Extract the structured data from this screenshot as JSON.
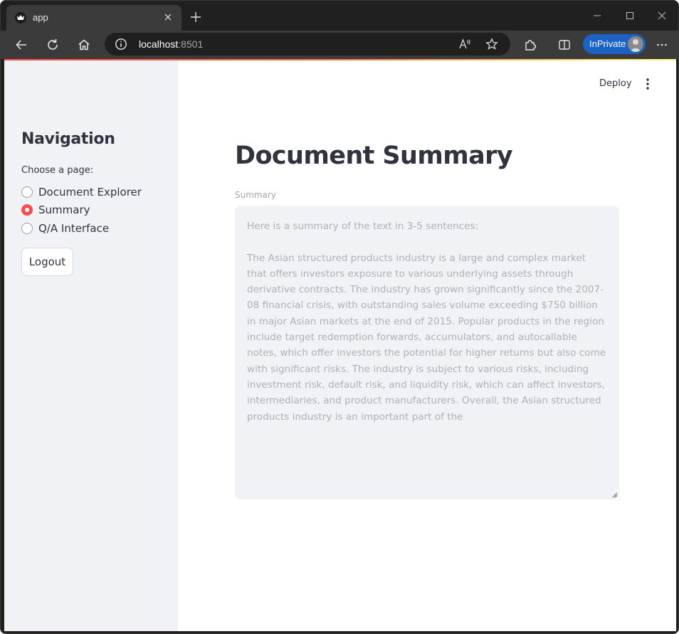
{
  "browser": {
    "tab_title": "app",
    "address_host": "localhost",
    "address_port": ":8501",
    "inprivate_label": "InPrivate"
  },
  "header": {
    "deploy_label": "Deploy"
  },
  "sidebar": {
    "title": "Navigation",
    "caption": "Choose a page:",
    "options": [
      "Document Explorer",
      "Summary",
      "Q/A Interface"
    ],
    "selected": "Summary",
    "logout_label": "Logout"
  },
  "main": {
    "title": "Document Summary",
    "summary_label": "Summary",
    "summary_text": "Here is a summary of the text in 3-5 sentences:\n\nThe Asian structured products industry is a large and complex market that offers investors exposure to various underlying assets through derivative contracts. The industry has grown significantly since the 2007-08 financial crisis, with outstanding sales volume exceeding $750 billion in major Asian markets at the end of 2015. Popular products in the region include target redemption forwards, accumulators, and autocallable notes, which offer investors the potential for higher returns but also come with significant risks. The industry is subject to various risks, including investment risk, default risk, and liquidity risk, which can affect investors, intermediaries, and product manufacturers. Overall, the Asian structured products industry is an important part of the"
  },
  "colors": {
    "accent": "#ff4b4b",
    "sidebar_bg": "#f0f2f6",
    "text": "#31333f",
    "inprivate": "#1a62c4"
  }
}
